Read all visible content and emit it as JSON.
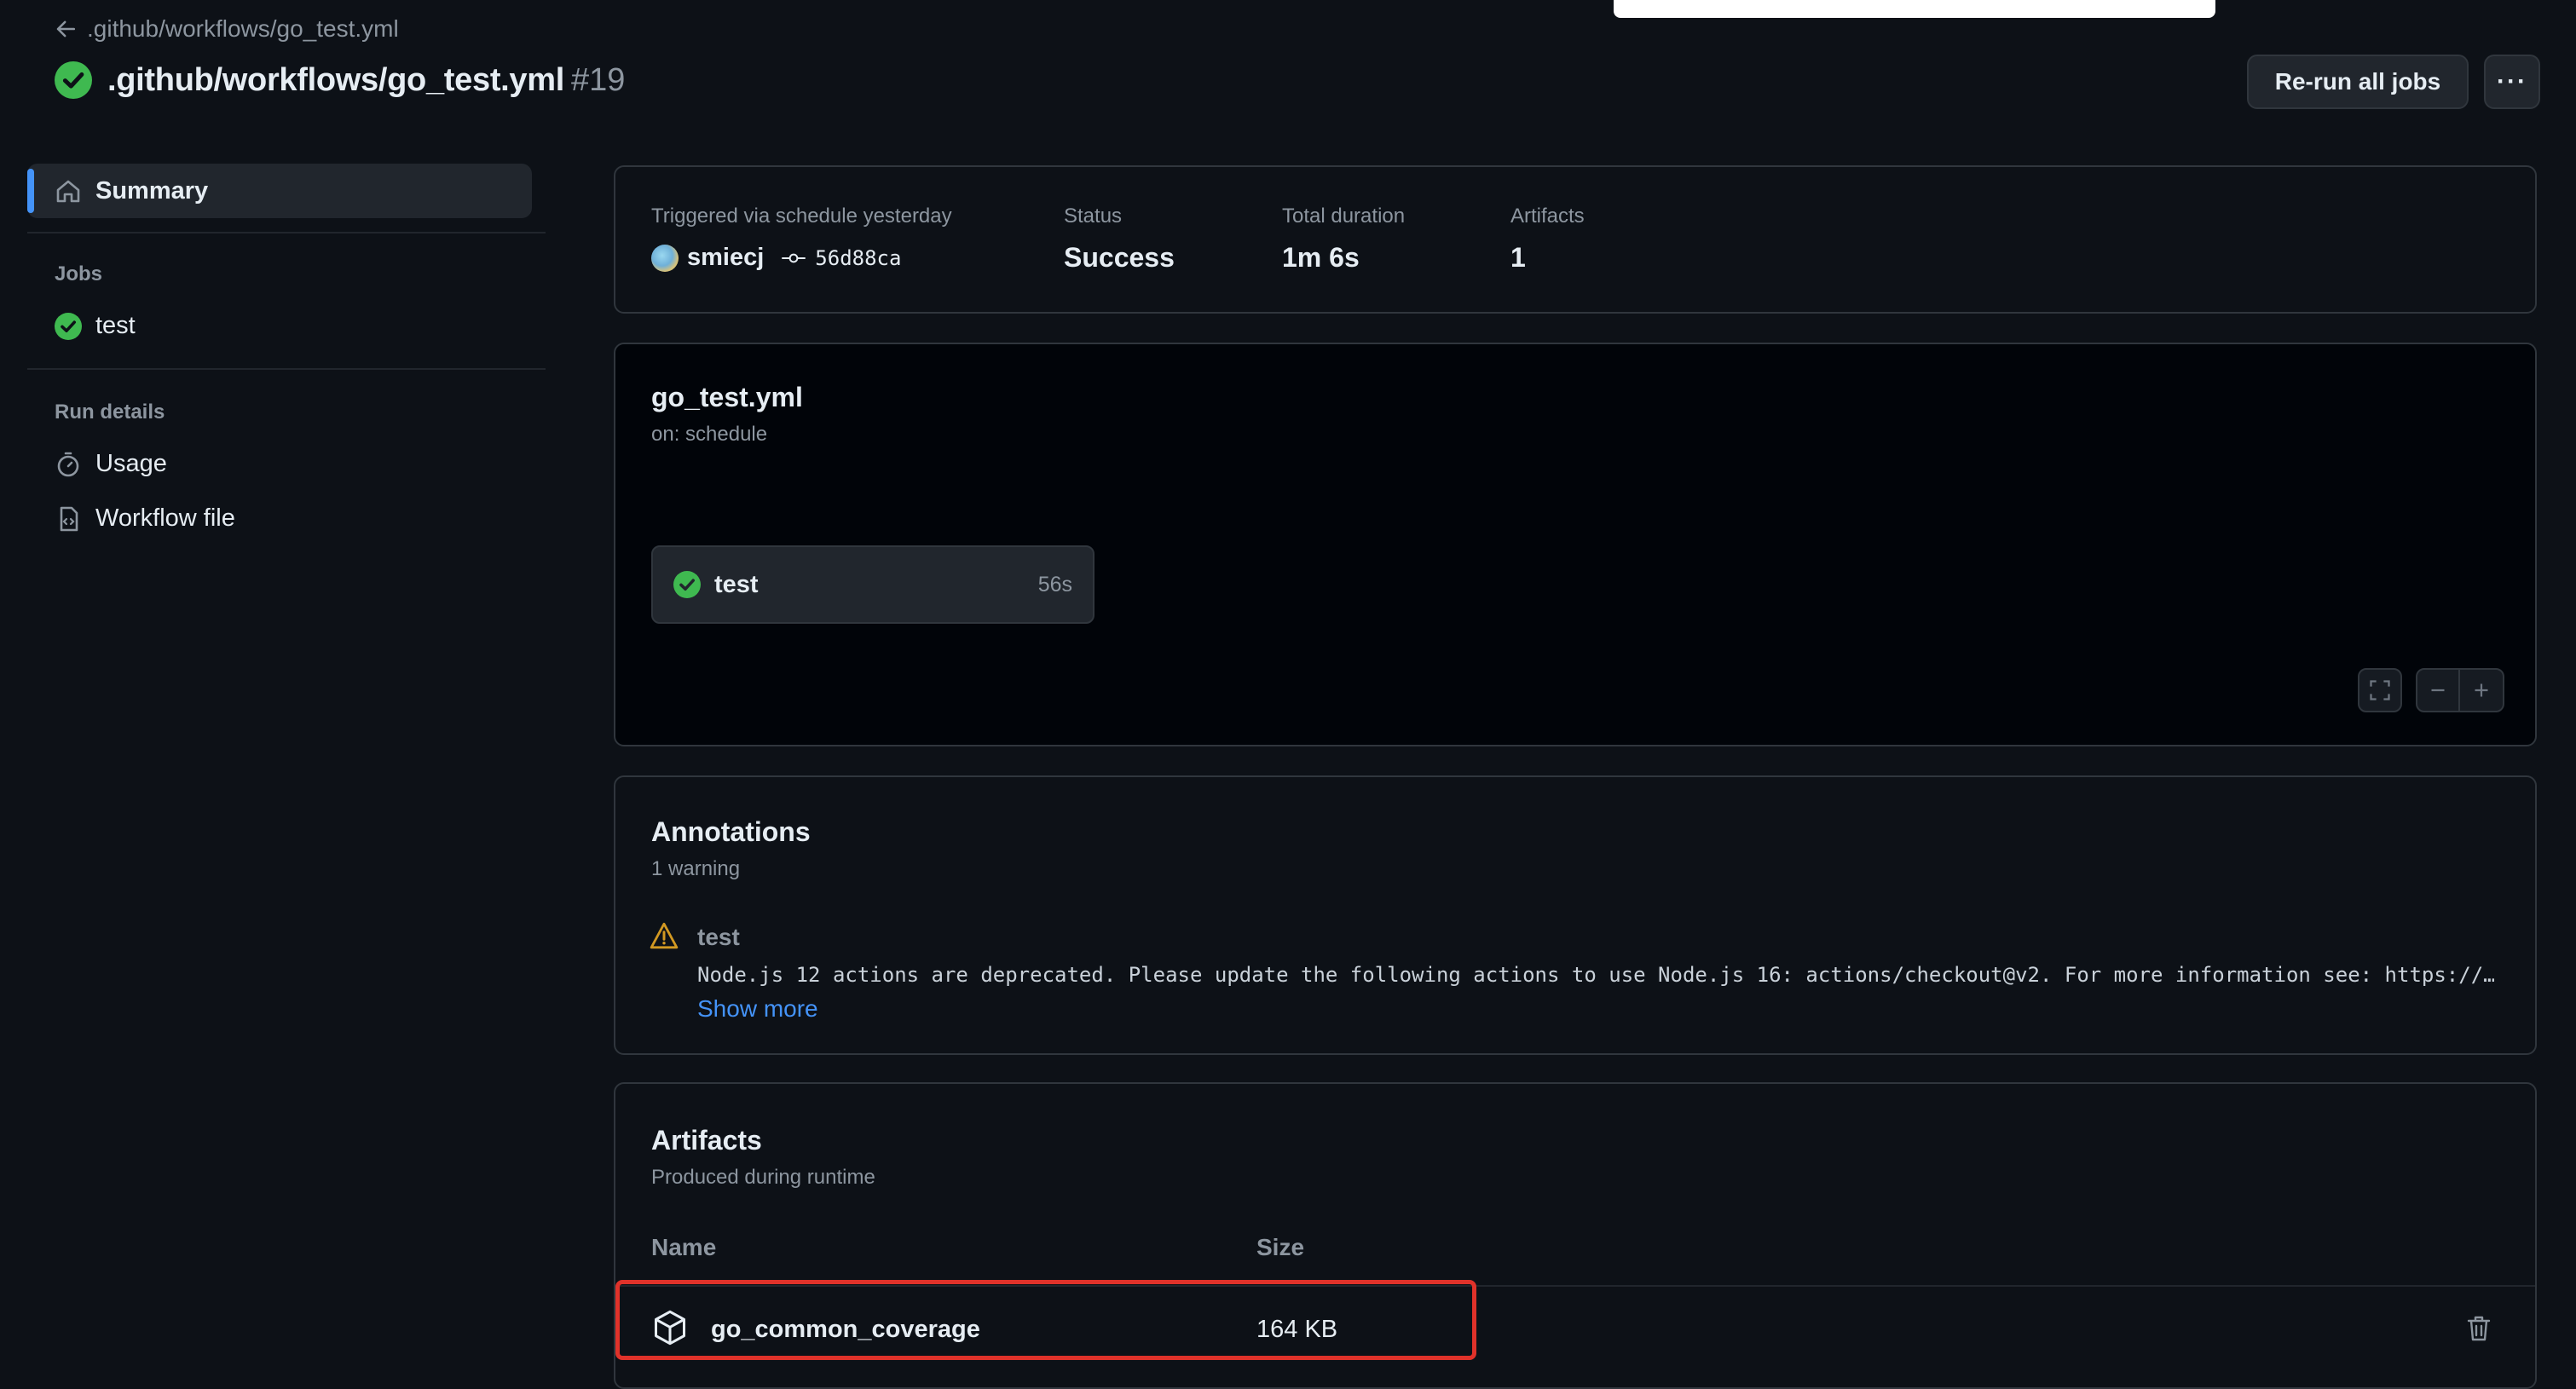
{
  "header": {
    "back_link": ".github/workflows/go_test.yml",
    "title": ".github/workflows/go_test.yml",
    "run_number": "#19",
    "rerun_label": "Re-run all jobs",
    "more_label": "···"
  },
  "sidebar": {
    "summary_label": "Summary",
    "jobs_heading": "Jobs",
    "jobs": [
      {
        "label": "test"
      }
    ],
    "run_details_heading": "Run details",
    "details": [
      {
        "label": "Usage"
      },
      {
        "label": "Workflow file"
      }
    ]
  },
  "summary": {
    "trigger_label": "Triggered via schedule yesterday",
    "user": "smiecj",
    "commit": "56d88ca",
    "status_label": "Status",
    "status_value": "Success",
    "duration_label": "Total duration",
    "duration_value": "1m 6s",
    "artifacts_label": "Artifacts",
    "artifacts_value": "1"
  },
  "graph": {
    "workflow_name": "go_test.yml",
    "trigger": "on: schedule",
    "job_name": "test",
    "job_duration": "56s"
  },
  "annotations": {
    "title": "Annotations",
    "count": "1 warning",
    "items": [
      {
        "job": "test",
        "message": "Node.js 12 actions are deprecated. Please update the following actions to use Node.js 16: actions/checkout@v2. For more information see: https://…",
        "show_more": "Show more"
      }
    ]
  },
  "artifacts": {
    "title": "Artifacts",
    "subtitle": "Produced during runtime",
    "col_name": "Name",
    "col_size": "Size",
    "rows": [
      {
        "name": "go_common_coverage",
        "size": "164 KB"
      }
    ]
  },
  "colors": {
    "success": "#3fb950",
    "warning": "#d29922",
    "accent": "#4493f8",
    "highlight": "#e0322a"
  }
}
